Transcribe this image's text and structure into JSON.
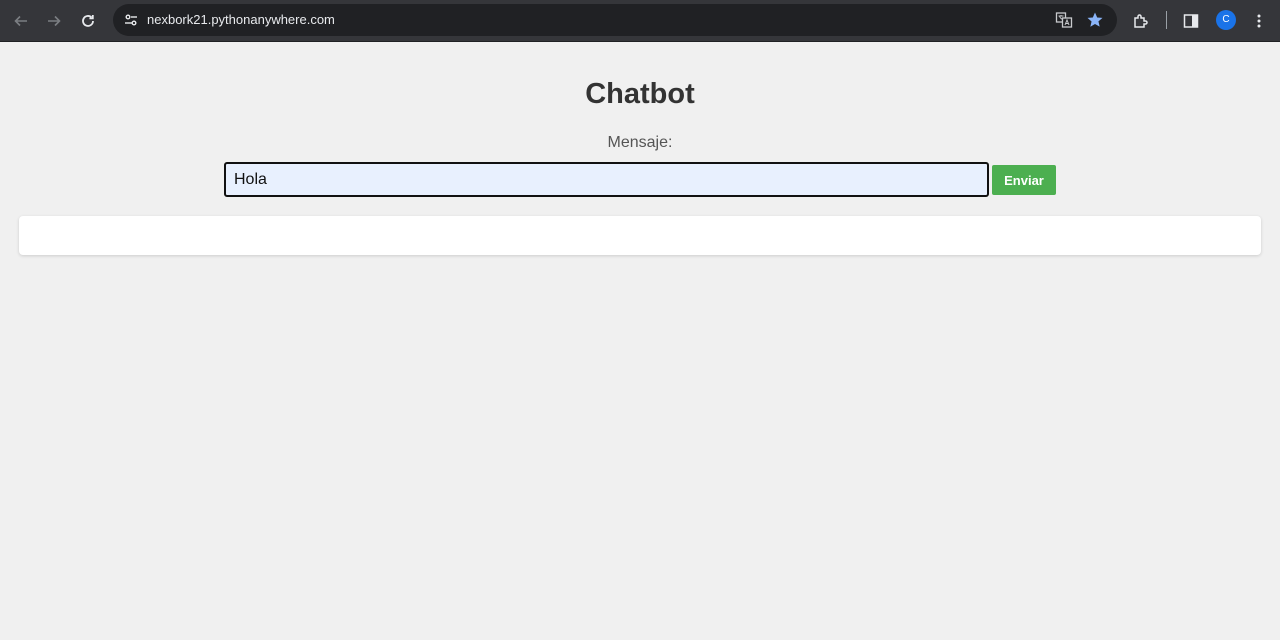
{
  "browser": {
    "url": "nexbork21.pythonanywhere.com",
    "profile_initial": "C",
    "icons": [
      "back-icon",
      "forward-icon",
      "reload-icon",
      "site-settings-icon",
      "translate-icon",
      "bookmark-star-icon",
      "extensions-icon",
      "side-panel-icon",
      "menu-icon"
    ]
  },
  "page": {
    "title": "Chatbot",
    "message_label": "Mensaje:",
    "message_value": "Hola",
    "send_label": "Enviar"
  },
  "colors": {
    "background": "#f0f0f0",
    "send_button": "#4caf50",
    "input_fill": "#e8f0fe"
  }
}
